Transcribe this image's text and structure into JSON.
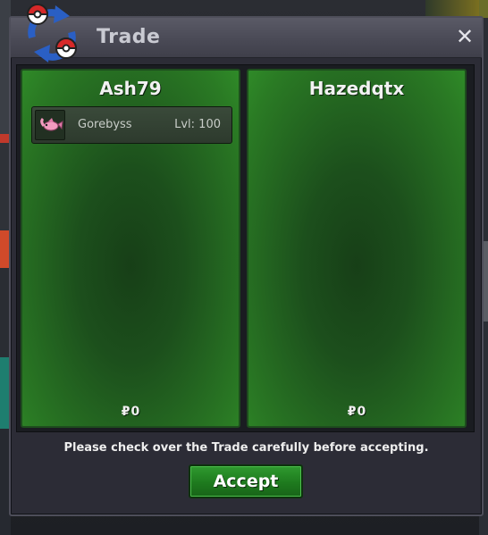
{
  "window": {
    "title": "Trade",
    "close_label": "✕"
  },
  "trade": {
    "left": {
      "player_name": "Ash79",
      "items": [
        {
          "name": "Gorebyss",
          "level": "Lvl: 100",
          "icon": "gorebyss-sprite-icon"
        }
      ],
      "money": "0"
    },
    "right": {
      "player_name": "Hazedqtx",
      "items": [],
      "money": "0"
    }
  },
  "footer": {
    "notice": "Please check over the Trade carefully before accepting.",
    "accept_label": "Accept"
  },
  "icons": {
    "title": "trade-swap-pokeball-icon",
    "currency": "pokedollar-icon"
  },
  "colors": {
    "panel_green": "#2f8a28",
    "accept_green": "#1e7a1e",
    "titlebar": "#4a4a56"
  }
}
